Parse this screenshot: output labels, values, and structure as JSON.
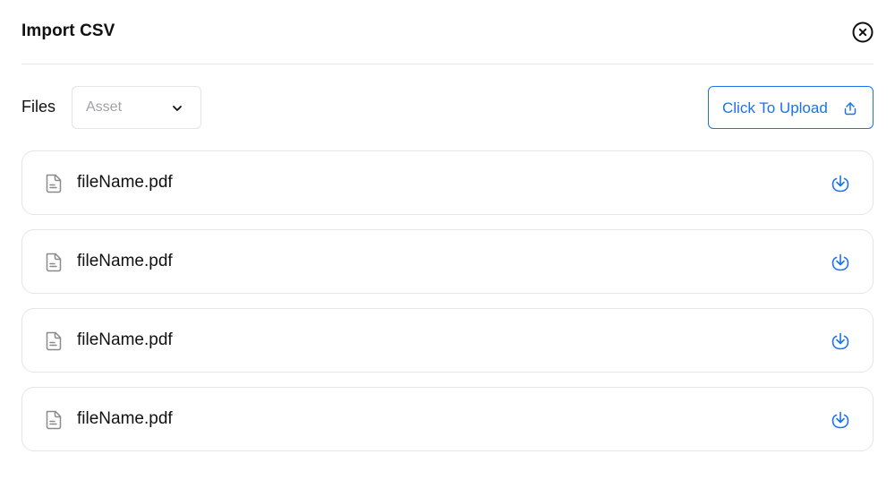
{
  "modal": {
    "title": "Import CSV",
    "close_icon": "close-circle-icon"
  },
  "toolbar": {
    "files_label": "Files",
    "select": {
      "placeholder": "Asset",
      "icon": "chevron-down-icon"
    },
    "upload_button": {
      "label": "Click To Upload",
      "icon": "upload-icon"
    }
  },
  "files": [
    {
      "name": "fileName.pdf",
      "file_icon": "document-icon",
      "action_icon": "download-icon"
    },
    {
      "name": "fileName.pdf",
      "file_icon": "document-icon",
      "action_icon": "download-icon"
    },
    {
      "name": "fileName.pdf",
      "file_icon": "document-icon",
      "action_icon": "download-icon"
    },
    {
      "name": "fileName.pdf",
      "file_icon": "document-icon",
      "action_icon": "download-icon"
    }
  ],
  "colors": {
    "accent": "#1a73e8",
    "border": "#e4e4e7",
    "text": "#111111",
    "placeholder": "#a1a1aa",
    "icon_muted": "#8a8a8a"
  }
}
